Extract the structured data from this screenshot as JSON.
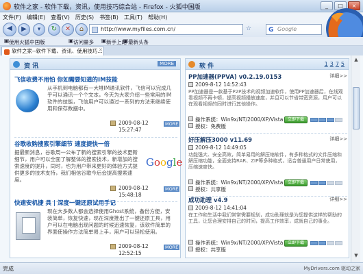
{
  "window": {
    "title": "软件之家 - 软件下载，资讯，使用技巧综合站 - Firefox - 火狐中国版",
    "min": "_",
    "max": "□",
    "close": "×"
  },
  "menu": [
    "文件(F)",
    "编辑(E)",
    "查看(V)",
    "历史(S)",
    "书签(B)",
    "工具(T)",
    "帮助(H)"
  ],
  "nav": {
    "url": "http://www.myfiles.com.cn/",
    "search_placeholder": "Google",
    "search_g": "G"
  },
  "bookmarks": [
    "使用火狐中国版",
    "访问量多",
    "新手上路",
    "最新头条"
  ],
  "tab": {
    "label": "软件之家--软件下载、资讯、使用技巧..."
  },
  "left_panel": {
    "title": "资 讯",
    "more": "MORE",
    "articles": [
      {
        "title": "飞信收费不用怕 你如需要知道的IM技能",
        "summary": "从手机到电脑都有一大堆IM通讯软件，飞信可以完成几乎可以通讯一个个文本，今天为大家介绍一些常用的IM软件的技能，飞信用户可以通过一系列的方法来继续使用和保存数据中。",
        "date": "2009-08-12",
        "time": "15:27:47",
        "more": "MORE"
      },
      {
        "title": "谷歌收购搜索引擎细节 速度提快一倍",
        "summary": "据最新消息，谷歌周一公布了新的搜索引擎的技术更新细节，用户可以全面了解整体的搜索技术，新增加的搜索速度的提升，同时，也为用户带来更好的体验方式提供更多的技术支持，我们相信谷歌今后会提高搜索速度。",
        "date": "2009-08-12",
        "time": "15:48:18",
        "more": "MORE"
      },
      {
        "title": "快速安机捷 具 | 深度一键还原试用手记",
        "summary": "现在大多数人都会选择使用Ghost系统，备份方便，安装简单，恢复快速，现在深度推出了一键还原工具，用户可以在电脑出现问题的时候迅速恢复，该软件简单的界面使操作方法简单易上手，用户可以轻松使用。",
        "date": "2009-08-12",
        "time": "12:52:15",
        "more": "MORE"
      }
    ]
  },
  "right_panel": {
    "title": "软 件",
    "pages": [
      "1",
      "3",
      "7",
      "5"
    ],
    "software": [
      {
        "name": "PP加速器(PPVA) v0.2.19.0153",
        "detail": "详细>>",
        "date": "2009-8-12 14:52:43",
        "desc": "PP加速器是一款基于P2P技术的视频加速软件，使用PP加速器后，在线观看视频不再卡顿，提高视频播放速度，并且可以节省带宽资源，用户可以在观看视频的同时进行其他操作。",
        "os_label": "操作系统：",
        "os": "Win9x/NT/2000/XP/Vista",
        "lic_label": "授权：",
        "license": "免费版",
        "download": "立即下载",
        "rating": 3
      },
      {
        "name": "好压解压3000 v11.69",
        "detail": "详细>>",
        "date": "2009-8-12 14:49:05",
        "desc": "功能强大、安全高效，简单易用的解压缩软件，有多种格式的文件压缩和解压缩功能，全面支持RAR、ZIP等多种格式，适合普通用户日常使用，压缩速度快。",
        "os_label": "操作系统：",
        "os": "Win9x/NT/2000/XP/Vista",
        "lic_label": "授权：",
        "license": "共享版",
        "download": "立即下载",
        "rating": 2
      },
      {
        "name": "成功助理 v4.9",
        "detail": "详细>>",
        "date": "2009-8-12 14:41:04",
        "desc": "在工作和生活中我们常常需要规划，成功助理就是为您提供这样的帮助的工具，让您合理安排自己的时间，提高工作效率，成就自己的事业。",
        "os_label": "操作系统：",
        "os": "Win9x/NT/2000/XP/Vista",
        "lic_label": "授权：",
        "license": "共享版",
        "download": "立即下载",
        "rating": 2
      }
    ]
  },
  "status": {
    "text": "完成",
    "watermark": "MyDrivers.com 驱动之家"
  }
}
